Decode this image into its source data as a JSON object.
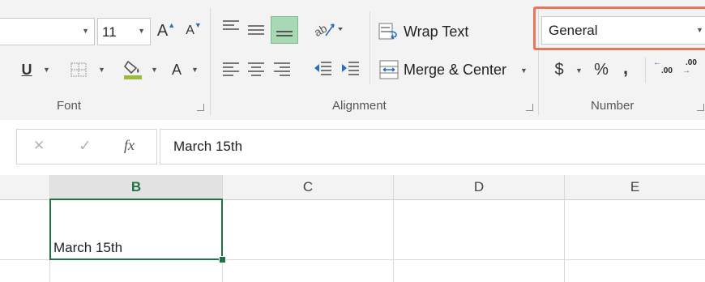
{
  "font_group": {
    "size_value": "11",
    "grow_label": "A",
    "shrink_label": "A",
    "underline_label": "U",
    "font_color_label": "A",
    "label": "Font"
  },
  "alignment_group": {
    "wrap_text_label": "Wrap Text",
    "merge_center_label": "Merge & Center",
    "label": "Alignment"
  },
  "number_group": {
    "format_value": "General",
    "currency_label": "$",
    "percent_label": "%",
    "comma_label": ",",
    "increase_decimal_label": ".00",
    "decrease_decimal_label": ".00",
    "label": "Number"
  },
  "formula_bar": {
    "cancel_icon": "✕",
    "enter_icon": "✓",
    "fx_label": "fx",
    "value": "March 15th"
  },
  "columns": [
    "B",
    "C",
    "D",
    "E"
  ],
  "active_cell": {
    "value": "March 15th"
  },
  "colors": {
    "highlight_border": "#e8775a",
    "active_green": "#217346",
    "selected_align_bg": "#a9d8b4"
  }
}
